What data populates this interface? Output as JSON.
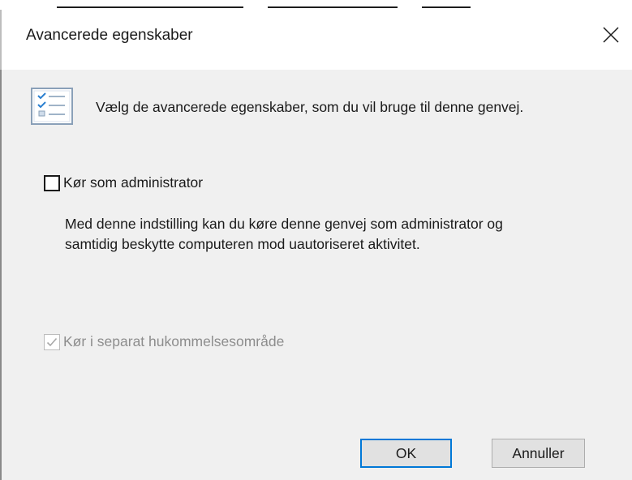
{
  "dialog": {
    "title": "Avancerede egenskaber",
    "close_label": "×"
  },
  "header": {
    "icon": "properties-list-icon",
    "description": "Vælg de avancerede egenskaber, som du vil bruge til denne genvej."
  },
  "options": {
    "run_as_admin": {
      "label": "Kør som administrator",
      "checked": false,
      "enabled": true
    },
    "info_text": "Med denne indstilling kan du køre denne genvej som administrator og samtidig beskytte computeren mod uautoriseret aktivitet.",
    "separate_memory": {
      "label": "Kør i separat hukommelsesområde",
      "checked": true,
      "enabled": false
    }
  },
  "buttons": {
    "ok_label": "OK",
    "cancel_label": "Annuller"
  },
  "colors": {
    "accent": "#0078d7",
    "disabled_text": "#8d8d8d",
    "background": "#f0f0f0"
  }
}
